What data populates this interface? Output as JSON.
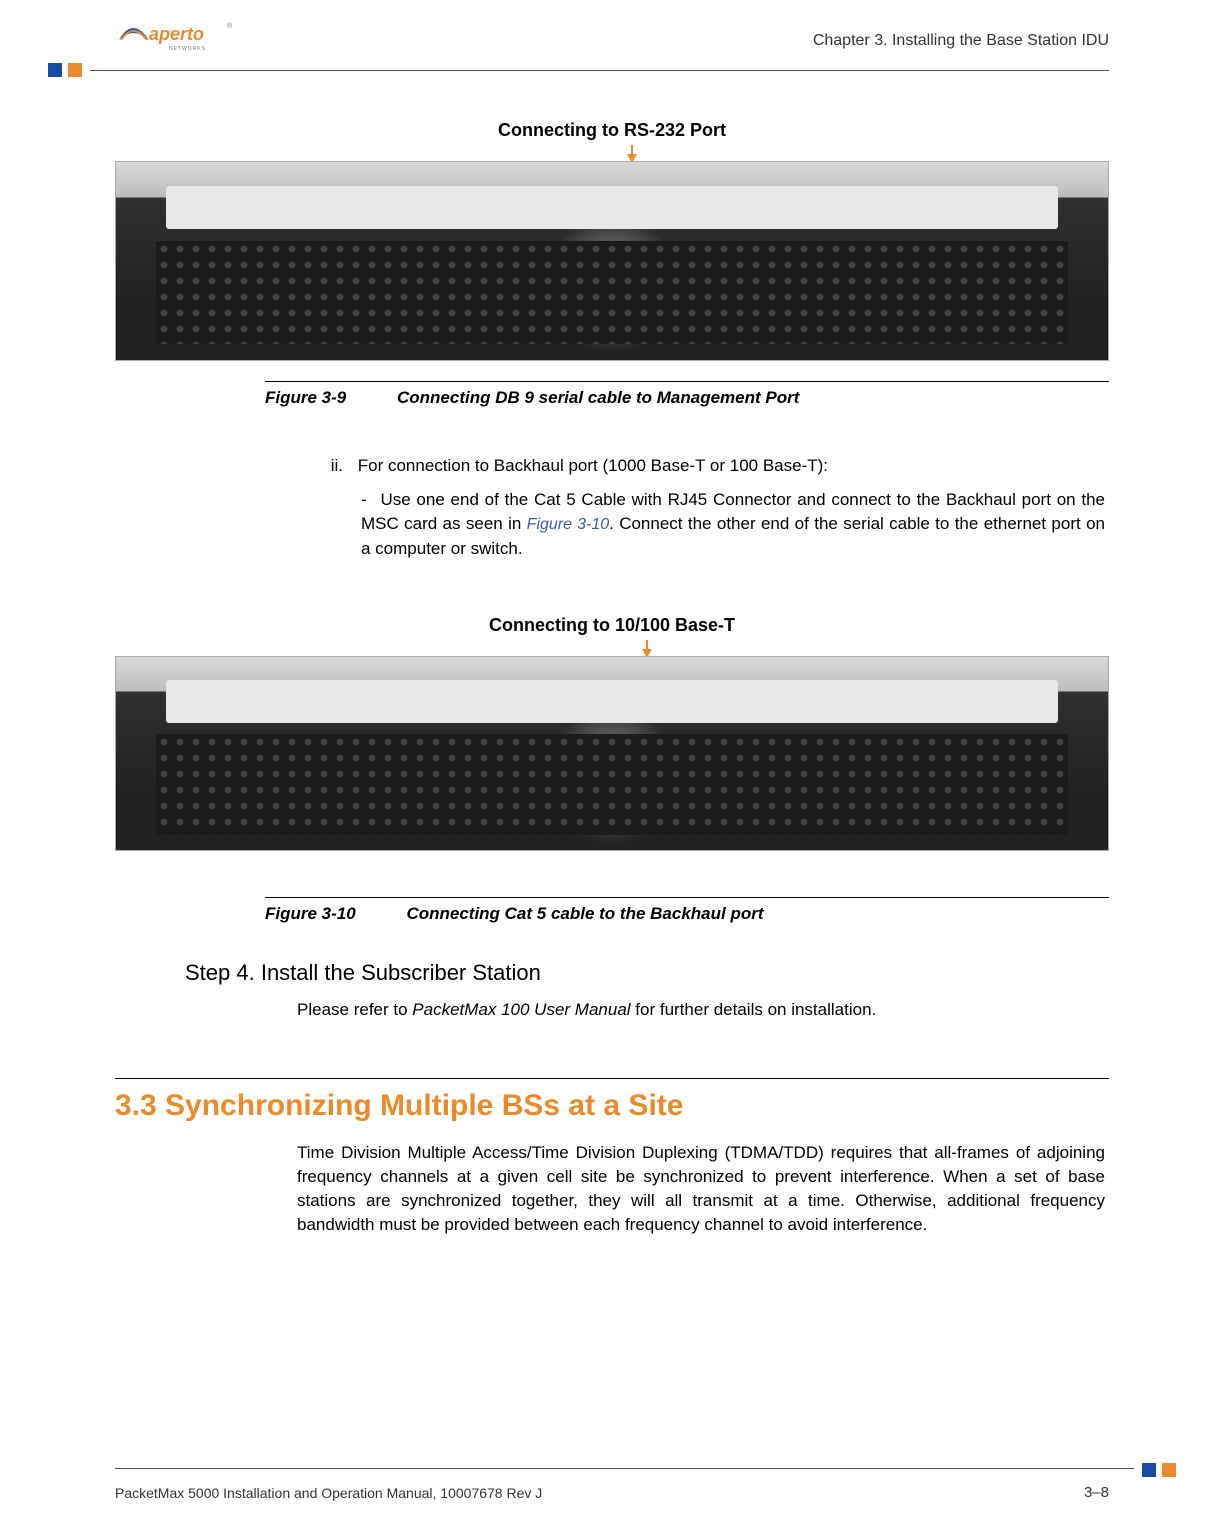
{
  "header": {
    "logo_text": "aperto",
    "logo_sub": "NETWORKS",
    "chapter": "Chapter 3.  Installing the Base Station IDU"
  },
  "figure1": {
    "callout": "Connecting to RS-232 Port",
    "label": "Figure 3-9",
    "title": "Connecting DB 9 serial cable to Management Port"
  },
  "step_ii": {
    "roman": "ii.",
    "lead": "For connection to Backhaul port (1000 Base-T or 100 Base-T):",
    "dash_pre": "Use one end of the Cat 5 Cable with RJ45 Connector and connect to the Backhaul port on the MSC card as seen in ",
    "fig_ref": "Figure 3-10",
    "dash_post": ".  Connect the other end of the serial cable to the ethernet port on a computer or switch."
  },
  "figure2": {
    "callout": "Connecting to 10/100 Base-T",
    "label": "Figure 3-10",
    "title": "Connecting Cat 5 cable to the Backhaul port"
  },
  "step4": {
    "title": "Step 4.  Install the Subscriber Station",
    "body_pre": "Please refer to ",
    "body_ital": "PacketMax 100 User Manual",
    "body_post": " for further details on installation."
  },
  "section33": {
    "title": "3.3 Synchronizing Multiple BSs at a Site",
    "body": "Time Division Multiple Access/Time Division Duplexing (TDMA/TDD) requires that all-frames of adjoining frequency channels at a given cell site be synchronized to prevent interference. When a set of base stations are synchronized together, they will all transmit at a time. Otherwise, additional frequency bandwidth must be provided between each frequency channel to avoid interference."
  },
  "footer": {
    "left": "PacketMax 5000 Installation and Operation Manual,   10007678 Rev J",
    "right": "3–8"
  },
  "colors": {
    "accent_orange": "#e98b2a",
    "accent_blue": "#1a4aa8"
  }
}
